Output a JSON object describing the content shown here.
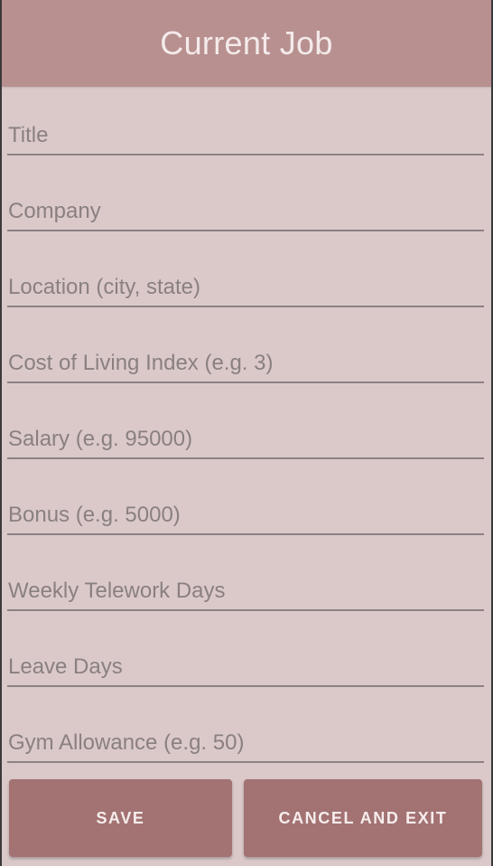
{
  "app_bar": {
    "title": "Current Job"
  },
  "form": {
    "fields": [
      {
        "placeholder": "Title",
        "value": ""
      },
      {
        "placeholder": "Company",
        "value": ""
      },
      {
        "placeholder": "Location (city, state)",
        "value": ""
      },
      {
        "placeholder": "Cost of Living Index (e.g. 3)",
        "value": ""
      },
      {
        "placeholder": "Salary (e.g. 95000)",
        "value": ""
      },
      {
        "placeholder": "Bonus (e.g. 5000)",
        "value": ""
      },
      {
        "placeholder": "Weekly Telework Days",
        "value": ""
      },
      {
        "placeholder": "Leave Days",
        "value": ""
      },
      {
        "placeholder": "Gym Allowance (e.g. 50)",
        "value": ""
      }
    ]
  },
  "actions": {
    "save_label": "SAVE",
    "cancel_label": "CANCEL AND EXIT"
  },
  "colors": {
    "app_bar": "#b89090",
    "background": "#dbc9ca",
    "button": "#a37272",
    "underline": "#8c8183"
  }
}
